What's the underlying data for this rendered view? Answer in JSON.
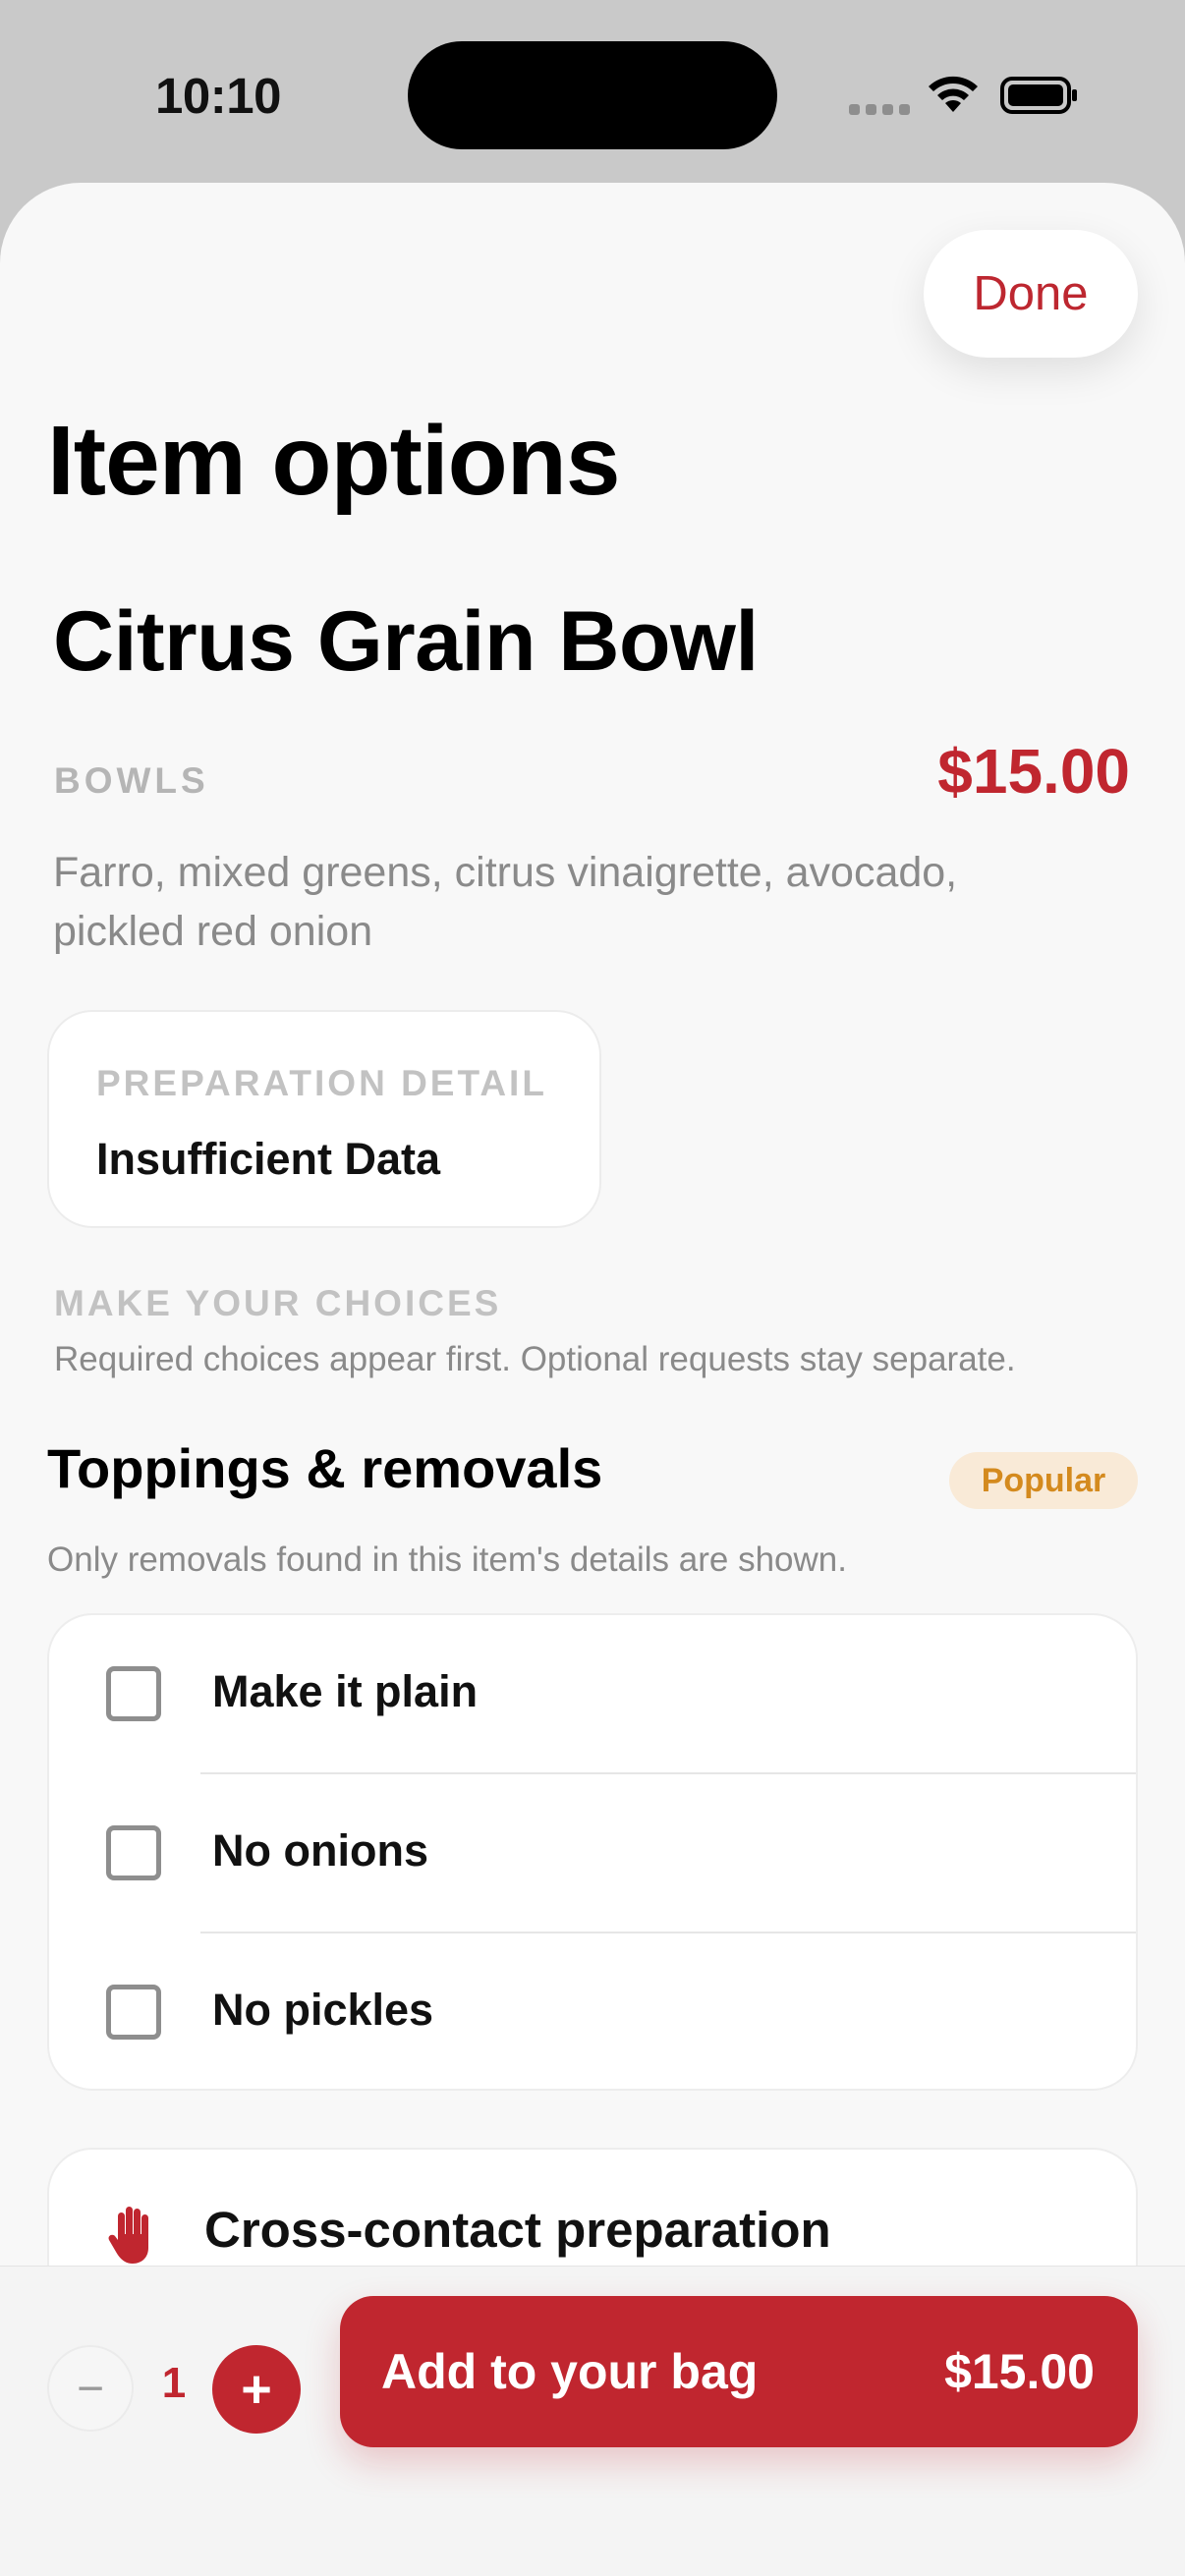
{
  "status_bar": {
    "time": "10:10"
  },
  "sheet": {
    "done_label": "Done",
    "title": "Item options"
  },
  "item": {
    "name": "Citrus Grain Bowl",
    "category": "BOWLS",
    "price": "$15.00",
    "description": "Farro, mixed greens, citrus vinaigrette, avocado, pickled red onion"
  },
  "preparation": {
    "label": "PREPARATION DETAIL",
    "value": "Insufficient Data"
  },
  "choices": {
    "label": "MAKE YOUR CHOICES",
    "subtitle": "Required choices appear first. Optional requests stay separate."
  },
  "toppings": {
    "title": "Toppings & removals",
    "badge": "Popular",
    "subtitle": "Only removals found in this item's details are shown.",
    "options": [
      {
        "label": "Make it plain",
        "checked": false
      },
      {
        "label": "No onions",
        "checked": false
      },
      {
        "label": "No pickles",
        "checked": false
      }
    ]
  },
  "cross_contact": {
    "label": "Cross-contact preparation",
    "icon": "hand-icon"
  },
  "bottom_bar": {
    "quantity": "1",
    "minus_symbol": "−",
    "plus_symbol": "+",
    "add_label": "Add to your bag",
    "add_price": "$15.00"
  },
  "colors": {
    "accent": "#c0262f",
    "badge_bg": "#f9ead7",
    "badge_text": "#d48a1e"
  }
}
